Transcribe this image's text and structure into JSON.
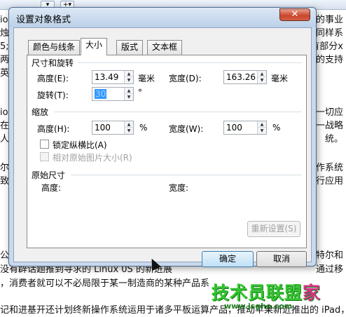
{
  "background_doc": {
    "lines": [
      {
        "left": "io出",
        "right": "大的事业"
      },
      {
        "left": "烛鹦",
        "right": "：同样系"
      },
      {
        "left": "5;同",
        "right": "有部分x"
      },
      {
        "left": "两家",
        "right": "的支持"
      },
      {
        "left": "英特",
        "right": ""
      },
      {
        "left": "",
        "right": ""
      },
      {
        "left": "io 操",
        "right": "等一切应"
      },
      {
        "left": "在新",
        "right": "同一战略"
      },
      {
        "left": "人员",
        "right": "统。"
      },
      {
        "left": "",
        "right": ""
      },
      {
        "left": "尔和",
        "right": "操作系统"
      },
      {
        "left": "致跟",
        "right": "运行应用"
      },
      {
        "left": "",
        "right": ""
      },
      {
        "left": "",
        "right": ""
      },
      {
        "left": "",
        "right": ""
      },
      {
        "left": "公司",
        "right": "然英特尔和"
      },
      {
        "left": "没有辟话题推到寻求的 Linux 0S 的新进展",
        "right": "通过移"
      },
      {
        "left": "，消费者就可以不必局限于某一制造商的某种产品系",
        "right": ""
      },
      {
        "left": "",
        "right": ""
      },
      {
        "left": "记和进基开还计划终新操作系统运用于诸多平板运算产品，推动苹果新近推出的 iPad，去特",
        "right": ""
      }
    ],
    "watermark": "技术员联盟",
    "watermark_accent": "家",
    "watermark_url": "www.jsgho.com"
  },
  "dialog": {
    "title": "设置对象格式",
    "close_label": "✕",
    "tabs": [
      {
        "label": "颜色与线条",
        "active": false
      },
      {
        "label": "大小",
        "active": true
      },
      {
        "label": "版式",
        "active": false
      },
      {
        "label": "文本框",
        "active": false
      }
    ],
    "size_section": {
      "title": "尺寸和旋转",
      "height_label": "高度(E):",
      "height_value": "13.49",
      "height_unit": "毫米",
      "width_label": "宽度(D):",
      "width_value": "163.26",
      "width_unit": "毫米",
      "rotation_label": "旋转(T):",
      "rotation_value": "30",
      "rotation_unit": "°"
    },
    "scale_section": {
      "title": "缩放",
      "height_label": "高度(H):",
      "height_value": "100",
      "height_unit": "%",
      "width_label": "宽度(W):",
      "width_value": "100",
      "width_unit": "%",
      "lock_aspect_label": "锁定纵横比(A)",
      "lock_aspect_checked": false,
      "relative_original_label": "相对原始图片大小(R)",
      "relative_original_enabled": false
    },
    "original_section": {
      "title": "原始尺寸",
      "height_label": "高度:",
      "width_label": "宽度:"
    },
    "reset_button": "重新设置(S)",
    "ok_button": "确定",
    "cancel_button": "取消"
  }
}
